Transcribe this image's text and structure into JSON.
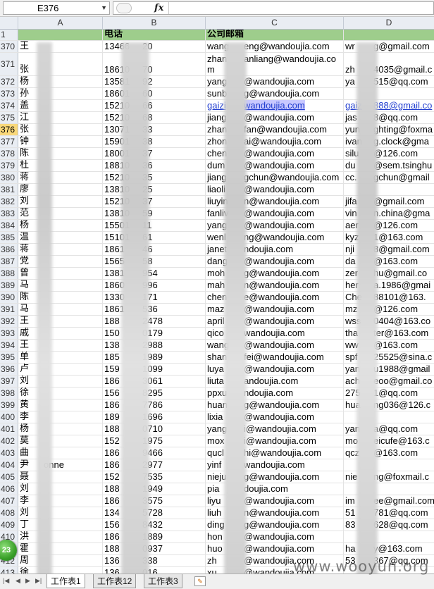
{
  "formula_bar": {
    "cell_ref": "E376",
    "fx": "fx"
  },
  "columns": [
    "A",
    "B",
    "C",
    "D"
  ],
  "header_row": {
    "num": "1",
    "b": "电话",
    "c": "公司邮箱"
  },
  "selected_row": "376",
  "rows": [
    {
      "num": "370",
      "a": "王",
      "b": "13466",
      "b2": "20",
      "c": "wang",
      "c2": "eng@wandoujia.com",
      "d": "wr",
      "d2": "g@gmail.com"
    },
    {
      "num": "371",
      "a": "张",
      "b": "18610",
      "b2": "70",
      "c": "zhan",
      "c2": "anliang@wandoujia.co",
      "c3": "m",
      "d": "zh",
      "d2": "4035@gmail.c"
    },
    {
      "num": "372",
      "a": "杨",
      "b": "13581",
      "b2": "92",
      "c": "yang",
      "c2": "@wandoujia.com",
      "d": "ya",
      "d2": "515@qq.com"
    },
    {
      "num": "373",
      "a": "孙",
      "b": "18601",
      "b2": "60",
      "c": "sunb",
      "c2": "g@wandoujia.com",
      "d": "",
      "d2": ""
    },
    {
      "num": "374",
      "a": "盖",
      "b": "15210",
      "b2": "66",
      "c": "gaizi",
      "c2": "wandoujia.com",
      "d": "gaiz",
      "d2": "888@gmail.co",
      "link": true
    },
    {
      "num": "375",
      "a": "江",
      "b": "15210",
      "b2": "68",
      "c": "jiang",
      "c2": "@wandoujia.com",
      "d": "jas",
      "d2": "8@qq.com"
    },
    {
      "num": "376",
      "a": "张",
      "b": "13071",
      "b2": "33",
      "c": "zhan",
      "c2": "fan@wandoujia.com",
      "d": "yun",
      "d2": "ghting@foxma"
    },
    {
      "num": "377",
      "a": "钟",
      "b": "15901",
      "b2": "38",
      "c": "zhon",
      "c2": "ai@wandoujia.com",
      "d": "ivan",
      "d2": "g.clock@gma"
    },
    {
      "num": "378",
      "a": "陈",
      "b": "18001",
      "b2": "37",
      "c": "chen",
      "c2": "@wandoujia.com",
      "d": "silu",
      "d2": "@126.com"
    },
    {
      "num": "379",
      "a": "杜",
      "b": "18810",
      "b2": "36",
      "c": "dum",
      "c2": "@wandoujia.com",
      "d": "du",
      "d2": "@sem.tsinghu"
    },
    {
      "num": "380",
      "a": "蒋",
      "b": "15210",
      "b2": "35",
      "c": "jiang",
      "c2": "gchun@wandoujia.com",
      "d": "cc.",
      "d2": "gchun@gmail"
    },
    {
      "num": "381",
      "a": "廖",
      "b": "13810",
      "b2": "25",
      "c": "liaoli",
      "c2": "@wandoujia.com",
      "d": "",
      "d2": ""
    },
    {
      "num": "382",
      "a": "刘",
      "b": "15210",
      "b2": "37",
      "c": "liuyin",
      "c2": "n@wandoujia.com",
      "d": "jifa",
      "d2": "@gmail.com"
    },
    {
      "num": "383",
      "a": "范",
      "b": "13810",
      "b2": "59",
      "c": "fanliv",
      "c2": "@wandoujia.com",
      "d": "vin",
      "d2": "n.china@gma"
    },
    {
      "num": "384",
      "a": "杨",
      "b": "15501",
      "b2": "11",
      "c": "yang",
      "c2": "@wandoujia.com",
      "d": "aer",
      "d2": "@126.com"
    },
    {
      "num": "385",
      "a": "温",
      "b": "15101",
      "b2": "61",
      "c": "wenl",
      "c2": "ng@wandoujia.com",
      "d": "kyz",
      "d2": "1@163.com"
    },
    {
      "num": "386",
      "a": "蒋",
      "b": "1861",
      "b2": "46",
      "c": "janet",
      "c2": "ndoujia.com",
      "d": "nji",
      "d2": "8@gmail.com"
    },
    {
      "num": "387",
      "a": "党",
      "b": "1565",
      "b2": "58",
      "c": "dang",
      "c2": "@wandoujia.com",
      "d": "da",
      "d2": "@163.com"
    },
    {
      "num": "388",
      "a": "曾",
      "b": "1381",
      "b2": "954",
      "c": "moh",
      "c2": "g@wandoujia.com",
      "d": "zer",
      "d2": "hu@gmail.co"
    },
    {
      "num": "389",
      "a": "马",
      "b": "1860",
      "b2": "996",
      "c": "mah",
      "c2": "n@wandoujia.com",
      "d": "her",
      "d2": "a.1986@gmai"
    },
    {
      "num": "390",
      "a": "陈",
      "b": "1330",
      "b2": "171",
      "c": "chen",
      "c2": "e@wandoujia.com",
      "d": "Che",
      "d2": "88101@163."
    },
    {
      "num": "391",
      "a": "马",
      "b": "1861",
      "b2": "536",
      "c": "maz",
      "c2": "@wandoujia.com",
      "d": "mz",
      "d2": "@126.com"
    },
    {
      "num": "392",
      "a": "王",
      "b": "188",
      "b2": "2478",
      "c": "april",
      "c2": "@wandoujia.com",
      "d": "wss",
      "d2": "0404@163.co"
    },
    {
      "num": "393",
      "a": "戚",
      "b": "150",
      "b2": "0179",
      "c": "qico",
      "c2": "wandoujia.com",
      "d": "tha",
      "d2": "ter@163.com"
    },
    {
      "num": "394",
      "a": "王",
      "b": "138",
      "b2": "2988",
      "c": "wang",
      "c2": "@wandoujia.com",
      "d": "ww",
      "d2": "@163.com"
    },
    {
      "num": "395",
      "a": "单",
      "b": "185",
      "b2": "1989",
      "c": "shan",
      "c2": "fei@wandoujia.com",
      "d": "spf",
      "d2": "25525@sina.c"
    },
    {
      "num": "396",
      "a": "卢",
      "b": "159",
      "b2": "1099",
      "c": "luya",
      "c2": "@wandoujia.com",
      "d": "yan",
      "d2": "u1988@gmail"
    },
    {
      "num": "397",
      "a": "刘",
      "b": "186",
      "b2": "3061",
      "c": "liuta",
      "c2": "andoujia.com",
      "d": "ach",
      "d2": "eoo@gmail.co"
    },
    {
      "num": "398",
      "a": "徐",
      "b": "156",
      "b2": "8295",
      "c": "ppxu",
      "c2": "ndoujia.com",
      "d": "275",
      "d2": "1@qq.com"
    },
    {
      "num": "399",
      "a": "黄",
      "b": "186",
      "b2": "7786",
      "c": "huan",
      "c2": "g@wandoujia.com",
      "d": "hua",
      "d2": "ng036@126.c"
    },
    {
      "num": "400",
      "a": "李",
      "b": "189",
      "b2": "1696",
      "c": "lixia",
      "c2": "@wandoujia.com",
      "d": "",
      "d2": ""
    },
    {
      "num": "401",
      "a": "杨",
      "b": "188",
      "b2": "0710",
      "c": "yang",
      "c2": "i@wandoujia.com",
      "d": "yan",
      "d2": "a@qq.com"
    },
    {
      "num": "402",
      "a": "莫",
      "b": "152",
      "b2": "1975",
      "c": "mox",
      "c2": "i@wandoujia.com",
      "d": "mo",
      "d2": "eicufe@163.c"
    },
    {
      "num": "403",
      "a": "曲",
      "b": "186",
      "b2": "9466",
      "c": "qucl",
      "c2": "hi@wandoujia.com",
      "d": "qcz",
      "d2": "@163.com"
    },
    {
      "num": "404",
      "a": "尹",
      "a2": "onne",
      "b": "186",
      "b2": "2977",
      "c": "yinf",
      "c2": "wandoujia.com",
      "d": "",
      "d2": ""
    },
    {
      "num": "405",
      "a": "聂",
      "b": "152",
      "b2": "7535",
      "c": "nieju",
      "c2": "g@wandoujia.com",
      "d": "nie",
      "d2": "ng@foxmail.c"
    },
    {
      "num": "406",
      "a": "刘",
      "b": "188",
      "b2": "1949",
      "c": "pia",
      "c2": "doujia.com",
      "d": "",
      "d2": ""
    },
    {
      "num": "407",
      "a": "李",
      "b": "186",
      "b2": "3575",
      "c": "liyu",
      "c2": "@wandoujia.com",
      "d": "im",
      "d2": "ee@gmail.com"
    },
    {
      "num": "408",
      "a": "刘",
      "b": "134",
      "b2": "5728",
      "c": "liuh",
      "c2": "n@wandoujia.com",
      "d": "51",
      "d2": "781@qq.com"
    },
    {
      "num": "409",
      "a": "丁",
      "b": "156",
      "b2": "8432",
      "c": "ding",
      "c2": "g@wandoujia.com",
      "d": "83",
      "d2": "628@qq.com"
    },
    {
      "num": "410",
      "a": "洪",
      "b": "186",
      "b2": "1889",
      "c": "hon",
      "c2": "@wandoujia.com",
      "d": "",
      "d2": ""
    },
    {
      "num": "411",
      "a": "霍",
      "b": "188",
      "b2": "0937",
      "c": "huo",
      "c2": "@wandoujia.com",
      "d": "ha",
      "d2": "y@163.com"
    },
    {
      "num": "412",
      "a": "周",
      "b": "136",
      "b2": "338",
      "c": "zh",
      "c2": "@wandoujia.com",
      "d": "53",
      "d2": "367@qq.com"
    },
    {
      "num": "413",
      "a": "徐",
      "b": "136",
      "b2": "016",
      "c": "xu",
      "c2": "@wandoujia.com",
      "d": "",
      "d2": ""
    }
  ],
  "sheet_tabs": [
    "工作表1",
    "工作表12",
    "工作表3"
  ],
  "badge": "23",
  "watermark": "www.wooyun.org"
}
